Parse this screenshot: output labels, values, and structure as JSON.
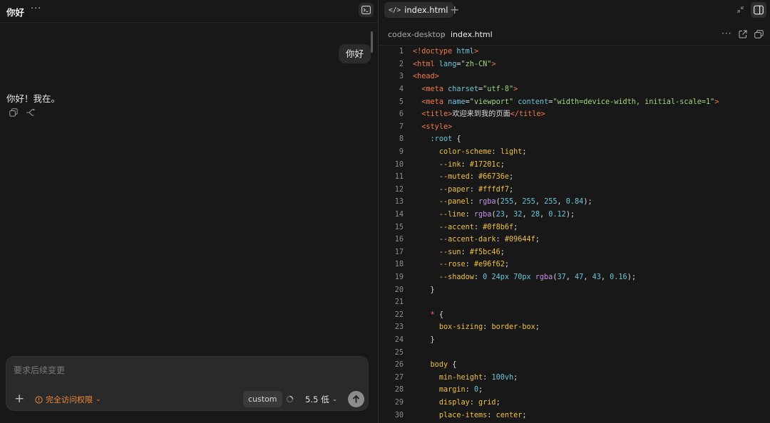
{
  "chat": {
    "title": "你好",
    "more_label": "···",
    "user_message": "你好",
    "assistant_message": "你好！我在。",
    "composer": {
      "placeholder": "要求后续变更",
      "add_label": "+",
      "access_label": "完全访问权限",
      "mode_label": "custom",
      "model_label": "5.5",
      "effort_label": "低"
    }
  },
  "editor": {
    "tab_label": "index.html",
    "tab_add_label": "+",
    "breadcrumb": {
      "root": "codex-desktop",
      "separator": "›",
      "file": "index.html"
    },
    "more_label": "···",
    "lines": [
      {
        "n": "1",
        "tokens": [
          [
            "t-tag",
            "<!doctype "
          ],
          [
            "t-attr",
            "html"
          ],
          [
            "t-tag",
            ">"
          ]
        ]
      },
      {
        "n": "2",
        "tokens": [
          [
            "t-tag",
            "<html "
          ],
          [
            "t-attr",
            "lang"
          ],
          [
            "",
            "="
          ],
          [
            "t-str",
            "\"zh-CN\""
          ],
          [
            "t-tag",
            ">"
          ]
        ]
      },
      {
        "n": "3",
        "tokens": [
          [
            "t-tag",
            "<head>"
          ]
        ]
      },
      {
        "n": "4",
        "tokens": [
          [
            "",
            "  "
          ],
          [
            "t-tag",
            "<meta "
          ],
          [
            "t-attr",
            "charset"
          ],
          [
            "",
            "="
          ],
          [
            "t-str",
            "\"utf-8\""
          ],
          [
            "t-tag",
            ">"
          ]
        ]
      },
      {
        "n": "5",
        "tokens": [
          [
            "",
            "  "
          ],
          [
            "t-tag",
            "<meta "
          ],
          [
            "t-attr",
            "name"
          ],
          [
            "",
            "="
          ],
          [
            "t-str",
            "\"viewport\""
          ],
          [
            "",
            " "
          ],
          [
            "t-attr",
            "content"
          ],
          [
            "",
            "="
          ],
          [
            "t-str",
            "\"width=device-width, initial-scale=1\""
          ],
          [
            "t-tag",
            ">"
          ]
        ]
      },
      {
        "n": "6",
        "tokens": [
          [
            "",
            "  "
          ],
          [
            "t-tag",
            "<title>"
          ],
          [
            "t-cjk",
            "欢迎来到我的页面"
          ],
          [
            "t-tag",
            "</title>"
          ]
        ]
      },
      {
        "n": "7",
        "tokens": [
          [
            "",
            "  "
          ],
          [
            "t-tag",
            "<style>"
          ]
        ]
      },
      {
        "n": "8",
        "tokens": [
          [
            "",
            "    "
          ],
          [
            "t-sel",
            ":root"
          ],
          [
            "",
            " {"
          ]
        ]
      },
      {
        "n": "9",
        "tokens": [
          [
            "",
            "      "
          ],
          [
            "t-prop",
            "color-scheme"
          ],
          [
            "",
            ": "
          ],
          [
            "t-kw",
            "light"
          ],
          [
            "",
            ";"
          ]
        ]
      },
      {
        "n": "10",
        "tokens": [
          [
            "",
            "      "
          ],
          [
            "t-prop",
            "--ink"
          ],
          [
            "",
            ": "
          ],
          [
            "t-kw",
            "#17201c"
          ],
          [
            "",
            ";"
          ]
        ]
      },
      {
        "n": "11",
        "tokens": [
          [
            "",
            "      "
          ],
          [
            "t-prop",
            "--muted"
          ],
          [
            "",
            ": "
          ],
          [
            "t-kw",
            "#66736e"
          ],
          [
            "",
            ";"
          ]
        ]
      },
      {
        "n": "12",
        "tokens": [
          [
            "",
            "      "
          ],
          [
            "t-prop",
            "--paper"
          ],
          [
            "",
            ": "
          ],
          [
            "t-kw",
            "#fffdf7"
          ],
          [
            "",
            ";"
          ]
        ]
      },
      {
        "n": "13",
        "tokens": [
          [
            "",
            "      "
          ],
          [
            "t-prop",
            "--panel"
          ],
          [
            "",
            ": "
          ],
          [
            "t-fn",
            "rgba"
          ],
          [
            "",
            "("
          ],
          [
            "t-num",
            "255"
          ],
          [
            "",
            ", "
          ],
          [
            "t-num",
            "255"
          ],
          [
            "",
            ", "
          ],
          [
            "t-num",
            "255"
          ],
          [
            "",
            ", "
          ],
          [
            "t-num",
            "0.84"
          ],
          [
            "",
            ");"
          ]
        ]
      },
      {
        "n": "14",
        "tokens": [
          [
            "",
            "      "
          ],
          [
            "t-prop",
            "--line"
          ],
          [
            "",
            ": "
          ],
          [
            "t-fn",
            "rgba"
          ],
          [
            "",
            "("
          ],
          [
            "t-num",
            "23"
          ],
          [
            "",
            ", "
          ],
          [
            "t-num",
            "32"
          ],
          [
            "",
            ", "
          ],
          [
            "t-num",
            "28"
          ],
          [
            "",
            ", "
          ],
          [
            "t-num",
            "0.12"
          ],
          [
            "",
            ");"
          ]
        ]
      },
      {
        "n": "15",
        "tokens": [
          [
            "",
            "      "
          ],
          [
            "t-prop",
            "--accent"
          ],
          [
            "",
            ": "
          ],
          [
            "t-kw",
            "#0f8b6f"
          ],
          [
            "",
            ";"
          ]
        ]
      },
      {
        "n": "16",
        "tokens": [
          [
            "",
            "      "
          ],
          [
            "t-prop",
            "--accent-dark"
          ],
          [
            "",
            ": "
          ],
          [
            "t-kw",
            "#09644f"
          ],
          [
            "",
            ";"
          ]
        ]
      },
      {
        "n": "17",
        "tokens": [
          [
            "",
            "      "
          ],
          [
            "t-prop",
            "--sun"
          ],
          [
            "",
            ": "
          ],
          [
            "t-kw",
            "#f5bc46"
          ],
          [
            "",
            ";"
          ]
        ]
      },
      {
        "n": "18",
        "tokens": [
          [
            "",
            "      "
          ],
          [
            "t-prop",
            "--rose"
          ],
          [
            "",
            ": "
          ],
          [
            "t-kw",
            "#e96f62"
          ],
          [
            "",
            ";"
          ]
        ]
      },
      {
        "n": "19",
        "tokens": [
          [
            "",
            "      "
          ],
          [
            "t-prop",
            "--shadow"
          ],
          [
            "",
            ": "
          ],
          [
            "t-num",
            "0 24px 70px "
          ],
          [
            "t-fn",
            "rgba"
          ],
          [
            "",
            "("
          ],
          [
            "t-num",
            "37"
          ],
          [
            "",
            ", "
          ],
          [
            "t-num",
            "47"
          ],
          [
            "",
            ", "
          ],
          [
            "t-num",
            "43"
          ],
          [
            "",
            ", "
          ],
          [
            "t-num",
            "0.16"
          ],
          [
            "",
            ");"
          ]
        ]
      },
      {
        "n": "20",
        "tokens": [
          [
            "",
            "    }"
          ]
        ]
      },
      {
        "n": "21",
        "tokens": []
      },
      {
        "n": "22",
        "tokens": [
          [
            "",
            "    "
          ],
          [
            "t-star",
            "*"
          ],
          [
            "",
            " {"
          ]
        ]
      },
      {
        "n": "23",
        "tokens": [
          [
            "",
            "      "
          ],
          [
            "t-prop",
            "box-sizing"
          ],
          [
            "",
            ": "
          ],
          [
            "t-kw",
            "border-box"
          ],
          [
            "",
            ";"
          ]
        ]
      },
      {
        "n": "24",
        "tokens": [
          [
            "",
            "    }"
          ]
        ]
      },
      {
        "n": "25",
        "tokens": []
      },
      {
        "n": "26",
        "tokens": [
          [
            "",
            "    "
          ],
          [
            "t-prop",
            "body"
          ],
          [
            "",
            " {"
          ]
        ]
      },
      {
        "n": "27",
        "tokens": [
          [
            "",
            "      "
          ],
          [
            "t-prop",
            "min-height"
          ],
          [
            "",
            ": "
          ],
          [
            "t-num",
            "100vh"
          ],
          [
            "",
            ";"
          ]
        ]
      },
      {
        "n": "28",
        "tokens": [
          [
            "",
            "      "
          ],
          [
            "t-prop",
            "margin"
          ],
          [
            "",
            ": "
          ],
          [
            "t-num",
            "0"
          ],
          [
            "",
            ";"
          ]
        ]
      },
      {
        "n": "29",
        "tokens": [
          [
            "",
            "      "
          ],
          [
            "t-prop",
            "display"
          ],
          [
            "",
            ": "
          ],
          [
            "t-kw",
            "grid"
          ],
          [
            "",
            ";"
          ]
        ]
      },
      {
        "n": "30",
        "tokens": [
          [
            "",
            "      "
          ],
          [
            "t-prop",
            "place-items"
          ],
          [
            "",
            ": "
          ],
          [
            "t-kw",
            "center"
          ],
          [
            "",
            ";"
          ]
        ]
      }
    ]
  }
}
